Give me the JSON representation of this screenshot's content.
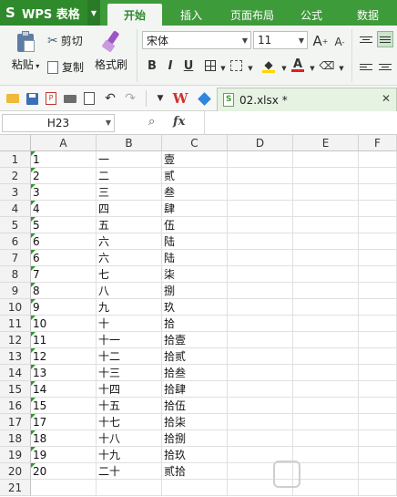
{
  "app": {
    "name": "WPS 表格"
  },
  "tabs": [
    "开始",
    "插入",
    "页面布局",
    "公式",
    "数据"
  ],
  "active_tab": "开始",
  "ribbon": {
    "paste": "粘贴",
    "cut": "剪切",
    "copy": "复制",
    "format_painter": "格式刷",
    "font_name": "宋体",
    "font_size": "11",
    "bold": "B",
    "italic": "I",
    "underline": "U",
    "grow_font": "A",
    "shrink_font": "A"
  },
  "file_tab": {
    "name": "02.xlsx *"
  },
  "formula_bar": {
    "cell_ref": "H23",
    "fx": "fx"
  },
  "columns": [
    "A",
    "B",
    "C",
    "D",
    "E",
    "F"
  ],
  "rows": [
    [
      "1",
      "一",
      "壹"
    ],
    [
      "2",
      "二",
      "贰"
    ],
    [
      "3",
      "三",
      "叁"
    ],
    [
      "4",
      "四",
      "肆"
    ],
    [
      "5",
      "五",
      "伍"
    ],
    [
      "6",
      "六",
      "陆"
    ],
    [
      "6",
      "六",
      "陆"
    ],
    [
      "7",
      "七",
      "柒"
    ],
    [
      "8",
      "八",
      "捌"
    ],
    [
      "9",
      "九",
      "玖"
    ],
    [
      "10",
      "十",
      "拾"
    ],
    [
      "11",
      "十一",
      "拾壹"
    ],
    [
      "12",
      "十二",
      "拾贰"
    ],
    [
      "13",
      "十三",
      "拾叁"
    ],
    [
      "14",
      "十四",
      "拾肆"
    ],
    [
      "15",
      "十五",
      "拾伍"
    ],
    [
      "17",
      "十七",
      "拾柒"
    ],
    [
      "18",
      "十八",
      "拾捌"
    ],
    [
      "19",
      "十九",
      "拾玖"
    ],
    [
      "20",
      "二十",
      "贰拾"
    ],
    [
      "",
      "",
      ""
    ]
  ],
  "colors": {
    "brand_green": "#3e9b3a",
    "error_marker": "#2f9a2f"
  }
}
